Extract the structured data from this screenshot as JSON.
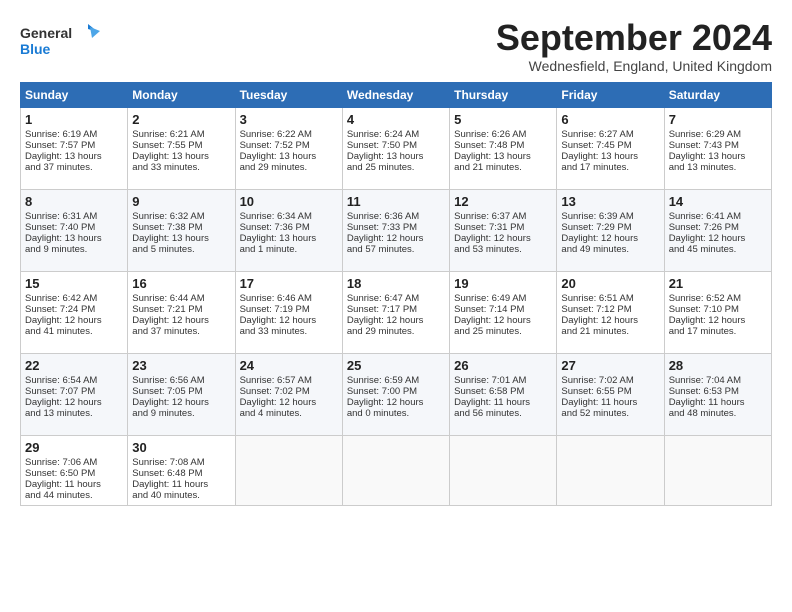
{
  "header": {
    "logo_general": "General",
    "logo_blue": "Blue",
    "title": "September 2024",
    "location": "Wednesfield, England, United Kingdom"
  },
  "weekdays": [
    "Sunday",
    "Monday",
    "Tuesday",
    "Wednesday",
    "Thursday",
    "Friday",
    "Saturday"
  ],
  "weeks": [
    [
      {
        "day": "1",
        "lines": [
          "Sunrise: 6:19 AM",
          "Sunset: 7:57 PM",
          "Daylight: 13 hours",
          "and 37 minutes."
        ]
      },
      {
        "day": "2",
        "lines": [
          "Sunrise: 6:21 AM",
          "Sunset: 7:55 PM",
          "Daylight: 13 hours",
          "and 33 minutes."
        ]
      },
      {
        "day": "3",
        "lines": [
          "Sunrise: 6:22 AM",
          "Sunset: 7:52 PM",
          "Daylight: 13 hours",
          "and 29 minutes."
        ]
      },
      {
        "day": "4",
        "lines": [
          "Sunrise: 6:24 AM",
          "Sunset: 7:50 PM",
          "Daylight: 13 hours",
          "and 25 minutes."
        ]
      },
      {
        "day": "5",
        "lines": [
          "Sunrise: 6:26 AM",
          "Sunset: 7:48 PM",
          "Daylight: 13 hours",
          "and 21 minutes."
        ]
      },
      {
        "day": "6",
        "lines": [
          "Sunrise: 6:27 AM",
          "Sunset: 7:45 PM",
          "Daylight: 13 hours",
          "and 17 minutes."
        ]
      },
      {
        "day": "7",
        "lines": [
          "Sunrise: 6:29 AM",
          "Sunset: 7:43 PM",
          "Daylight: 13 hours",
          "and 13 minutes."
        ]
      }
    ],
    [
      {
        "day": "8",
        "lines": [
          "Sunrise: 6:31 AM",
          "Sunset: 7:40 PM",
          "Daylight: 13 hours",
          "and 9 minutes."
        ]
      },
      {
        "day": "9",
        "lines": [
          "Sunrise: 6:32 AM",
          "Sunset: 7:38 PM",
          "Daylight: 13 hours",
          "and 5 minutes."
        ]
      },
      {
        "day": "10",
        "lines": [
          "Sunrise: 6:34 AM",
          "Sunset: 7:36 PM",
          "Daylight: 13 hours",
          "and 1 minute."
        ]
      },
      {
        "day": "11",
        "lines": [
          "Sunrise: 6:36 AM",
          "Sunset: 7:33 PM",
          "Daylight: 12 hours",
          "and 57 minutes."
        ]
      },
      {
        "day": "12",
        "lines": [
          "Sunrise: 6:37 AM",
          "Sunset: 7:31 PM",
          "Daylight: 12 hours",
          "and 53 minutes."
        ]
      },
      {
        "day": "13",
        "lines": [
          "Sunrise: 6:39 AM",
          "Sunset: 7:29 PM",
          "Daylight: 12 hours",
          "and 49 minutes."
        ]
      },
      {
        "day": "14",
        "lines": [
          "Sunrise: 6:41 AM",
          "Sunset: 7:26 PM",
          "Daylight: 12 hours",
          "and 45 minutes."
        ]
      }
    ],
    [
      {
        "day": "15",
        "lines": [
          "Sunrise: 6:42 AM",
          "Sunset: 7:24 PM",
          "Daylight: 12 hours",
          "and 41 minutes."
        ]
      },
      {
        "day": "16",
        "lines": [
          "Sunrise: 6:44 AM",
          "Sunset: 7:21 PM",
          "Daylight: 12 hours",
          "and 37 minutes."
        ]
      },
      {
        "day": "17",
        "lines": [
          "Sunrise: 6:46 AM",
          "Sunset: 7:19 PM",
          "Daylight: 12 hours",
          "and 33 minutes."
        ]
      },
      {
        "day": "18",
        "lines": [
          "Sunrise: 6:47 AM",
          "Sunset: 7:17 PM",
          "Daylight: 12 hours",
          "and 29 minutes."
        ]
      },
      {
        "day": "19",
        "lines": [
          "Sunrise: 6:49 AM",
          "Sunset: 7:14 PM",
          "Daylight: 12 hours",
          "and 25 minutes."
        ]
      },
      {
        "day": "20",
        "lines": [
          "Sunrise: 6:51 AM",
          "Sunset: 7:12 PM",
          "Daylight: 12 hours",
          "and 21 minutes."
        ]
      },
      {
        "day": "21",
        "lines": [
          "Sunrise: 6:52 AM",
          "Sunset: 7:10 PM",
          "Daylight: 12 hours",
          "and 17 minutes."
        ]
      }
    ],
    [
      {
        "day": "22",
        "lines": [
          "Sunrise: 6:54 AM",
          "Sunset: 7:07 PM",
          "Daylight: 12 hours",
          "and 13 minutes."
        ]
      },
      {
        "day": "23",
        "lines": [
          "Sunrise: 6:56 AM",
          "Sunset: 7:05 PM",
          "Daylight: 12 hours",
          "and 9 minutes."
        ]
      },
      {
        "day": "24",
        "lines": [
          "Sunrise: 6:57 AM",
          "Sunset: 7:02 PM",
          "Daylight: 12 hours",
          "and 4 minutes."
        ]
      },
      {
        "day": "25",
        "lines": [
          "Sunrise: 6:59 AM",
          "Sunset: 7:00 PM",
          "Daylight: 12 hours",
          "and 0 minutes."
        ]
      },
      {
        "day": "26",
        "lines": [
          "Sunrise: 7:01 AM",
          "Sunset: 6:58 PM",
          "Daylight: 11 hours",
          "and 56 minutes."
        ]
      },
      {
        "day": "27",
        "lines": [
          "Sunrise: 7:02 AM",
          "Sunset: 6:55 PM",
          "Daylight: 11 hours",
          "and 52 minutes."
        ]
      },
      {
        "day": "28",
        "lines": [
          "Sunrise: 7:04 AM",
          "Sunset: 6:53 PM",
          "Daylight: 11 hours",
          "and 48 minutes."
        ]
      }
    ],
    [
      {
        "day": "29",
        "lines": [
          "Sunrise: 7:06 AM",
          "Sunset: 6:50 PM",
          "Daylight: 11 hours",
          "and 44 minutes."
        ]
      },
      {
        "day": "30",
        "lines": [
          "Sunrise: 7:08 AM",
          "Sunset: 6:48 PM",
          "Daylight: 11 hours",
          "and 40 minutes."
        ]
      },
      {
        "day": "",
        "lines": []
      },
      {
        "day": "",
        "lines": []
      },
      {
        "day": "",
        "lines": []
      },
      {
        "day": "",
        "lines": []
      },
      {
        "day": "",
        "lines": []
      }
    ]
  ]
}
